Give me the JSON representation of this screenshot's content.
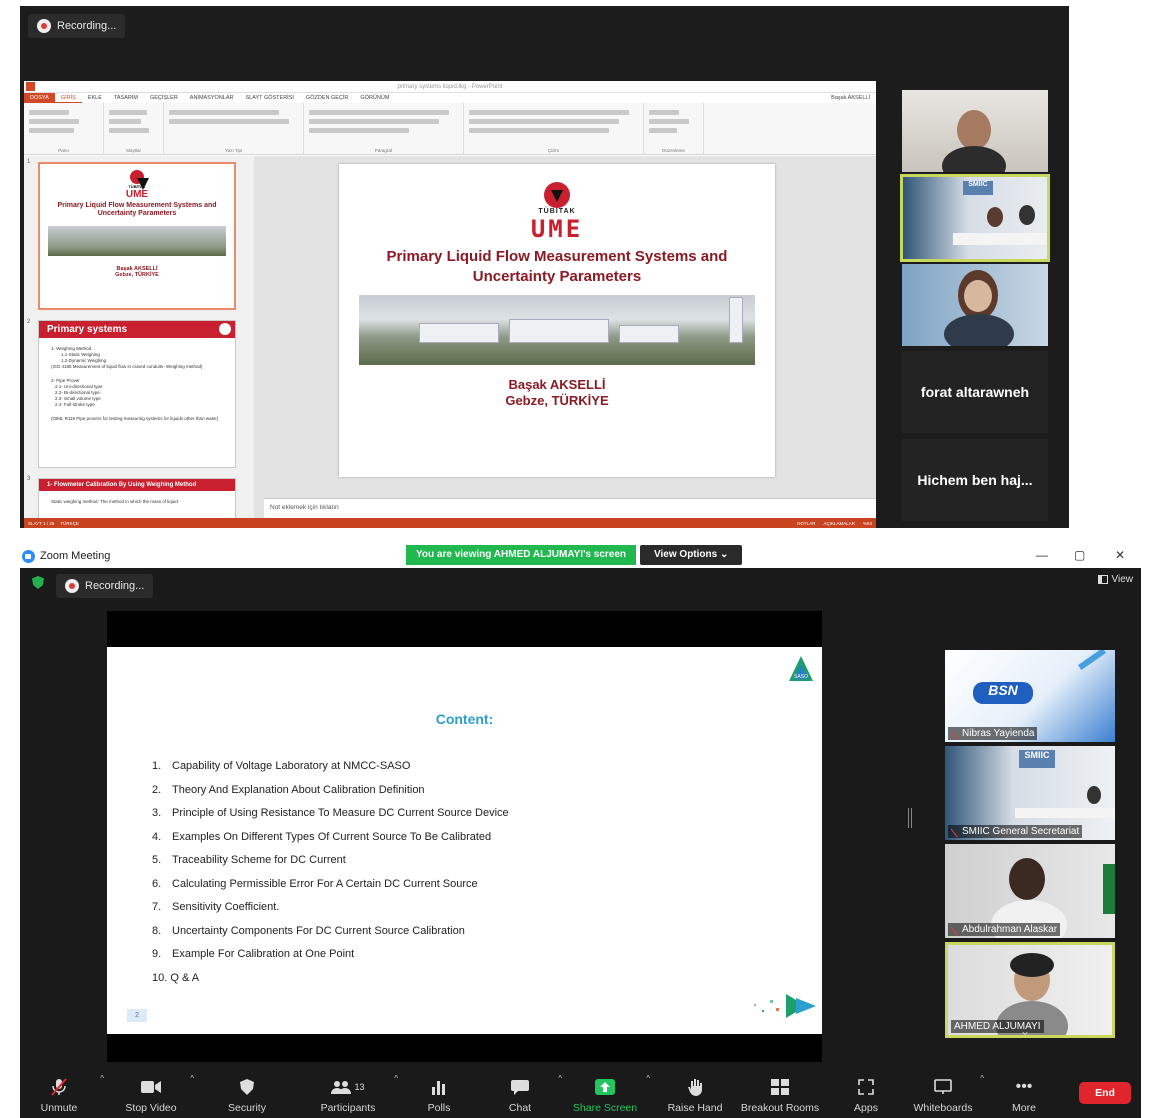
{
  "top": {
    "recording_label": "Recording...",
    "ppt": {
      "window_title": "primary systems liquid.tkg - PowerPoint",
      "tabs": [
        "DOSYA",
        "GİRİŞ",
        "EKLE",
        "TASARIM",
        "GEÇİŞLER",
        "ANİMASYONLAR",
        "SLAYT GÖSTERİSİ",
        "GÖZDEN GEÇİR",
        "GÖRÜNÜM"
      ],
      "user": "Başak AKSELLİ",
      "ribbon_groups": [
        "Pano",
        "Slaytlar",
        "Yazı Tipi",
        "Paragraf",
        "Çizim",
        "Düzenleme"
      ],
      "thumbs": [
        {
          "num": "1",
          "ume": "UME",
          "tubitak": "TÜBİTAK",
          "title": "Primary Liquid Flow Measurement Systems and Uncertainty Parameters",
          "author": "Başak AKSELLİ",
          "place": "Gebze, TÜRKİYE"
        },
        {
          "num": "2",
          "title": "Primary systems",
          "lines": [
            "1- Weighing Method",
            "1.1-Static Weighing",
            "1.2-Dynamic Weighing",
            "(ISO 4185 Measurement of liquid flow in closed conduits- Weighing method)",
            "2- Pipe Prover",
            "2.1- Uni-directional type",
            "2.2- Bi-directional type",
            "2.3- Small volume type",
            "2.4- Full-stroke type",
            "(OIML R119 Pipe provers for testing measuring systems for liquids other than water)"
          ]
        },
        {
          "num": "3",
          "title": "1- Flowmeter Calibration By Using Weighing Method",
          "line": "Static weighing method: The method in which the mass of liquid"
        }
      ],
      "slide": {
        "tubitak": "TÜBİTAK",
        "ume": "UME",
        "title_line1": "Primary Liquid Flow Measurement Systems and",
        "title_line2": "Uncertainty Parameters",
        "author": "Başak AKSELLİ",
        "place": "Gebze, TÜRKİYE"
      },
      "notes_placeholder": "Not eklemek için tıklatın",
      "status_left": "SLAYT 1 / 25",
      "status_lang": "TÜRKÇE",
      "status_notes": "NOTLAR",
      "status_comments": "AÇIKLAMALAR",
      "zoom_level": "%84"
    },
    "participants": [
      {
        "label": ""
      },
      {
        "label": ""
      },
      {
        "label": ""
      },
      {
        "label": "forat altarawneh"
      },
      {
        "label": "Hichem ben haj..."
      }
    ]
  },
  "zoom": {
    "app_title": "Zoom Meeting",
    "viewing_banner": "You are viewing AHMED ALJUMAYI's screen",
    "view_options": "View Options",
    "recording_label": "Recording...",
    "view_label": "View",
    "slide": {
      "heading": "Content:",
      "items": [
        {
          "n": "1.",
          "text": "Capability of Voltage Laboratory at NMCC-SASO"
        },
        {
          "n": "2.",
          "text": "Theory And Explanation About Calibration Definition"
        },
        {
          "n": "3.",
          "text": "Principle of Using Resistance To Measure DC Current Source Device"
        },
        {
          "n": "4.",
          "text": "Examples On Different Types Of Current Source To Be Calibrated"
        },
        {
          "n": "5.",
          "text": "Traceability Scheme for DC Current"
        },
        {
          "n": "6.",
          "text": "Calculating Permissible Error For A Certain DC Current Source"
        },
        {
          "n": "7.",
          "text": "Sensitivity Coefficient."
        },
        {
          "n": "8.",
          "text": "Uncertainty Components For DC Current Source Calibration"
        },
        {
          "n": "9.",
          "text": "Example For Calibration at  One Point"
        },
        {
          "n": "10.",
          "text": "Q & A"
        }
      ],
      "page_number": "2",
      "logo_text": "SASO"
    },
    "tiles": [
      {
        "name": "Nibras Yayienda",
        "banner": "BSN"
      },
      {
        "name": "SMIIC General Secretariat",
        "banner": "SMIIC"
      },
      {
        "name": "Abdulrahman Alaskar"
      },
      {
        "name": "AHMED ALJUMAYI"
      }
    ],
    "toolbar": [
      {
        "label": "Unmute",
        "icon": "microphone-muted-icon"
      },
      {
        "label": "Stop Video",
        "icon": "video-camera-icon"
      },
      {
        "label": "Security",
        "icon": "shield-icon"
      },
      {
        "label": "Participants",
        "icon": "participants-icon",
        "count": "13"
      },
      {
        "label": "Polls",
        "icon": "polls-icon"
      },
      {
        "label": "Chat",
        "icon": "chat-icon"
      },
      {
        "label": "Share Screen",
        "icon": "share-screen-icon"
      },
      {
        "label": "Raise Hand",
        "icon": "raise-hand-icon"
      },
      {
        "label": "Breakout Rooms",
        "icon": "breakout-rooms-icon"
      },
      {
        "label": "Apps",
        "icon": "apps-icon"
      },
      {
        "label": "Whiteboards",
        "icon": "whiteboard-icon"
      },
      {
        "label": "More",
        "icon": "more-icon"
      }
    ],
    "end_label": "End",
    "colors": {
      "share_green": "#22c55e",
      "active_border": "#c8d85e",
      "end_red": "#e0262c",
      "heading_blue": "#2b9fd0"
    }
  }
}
